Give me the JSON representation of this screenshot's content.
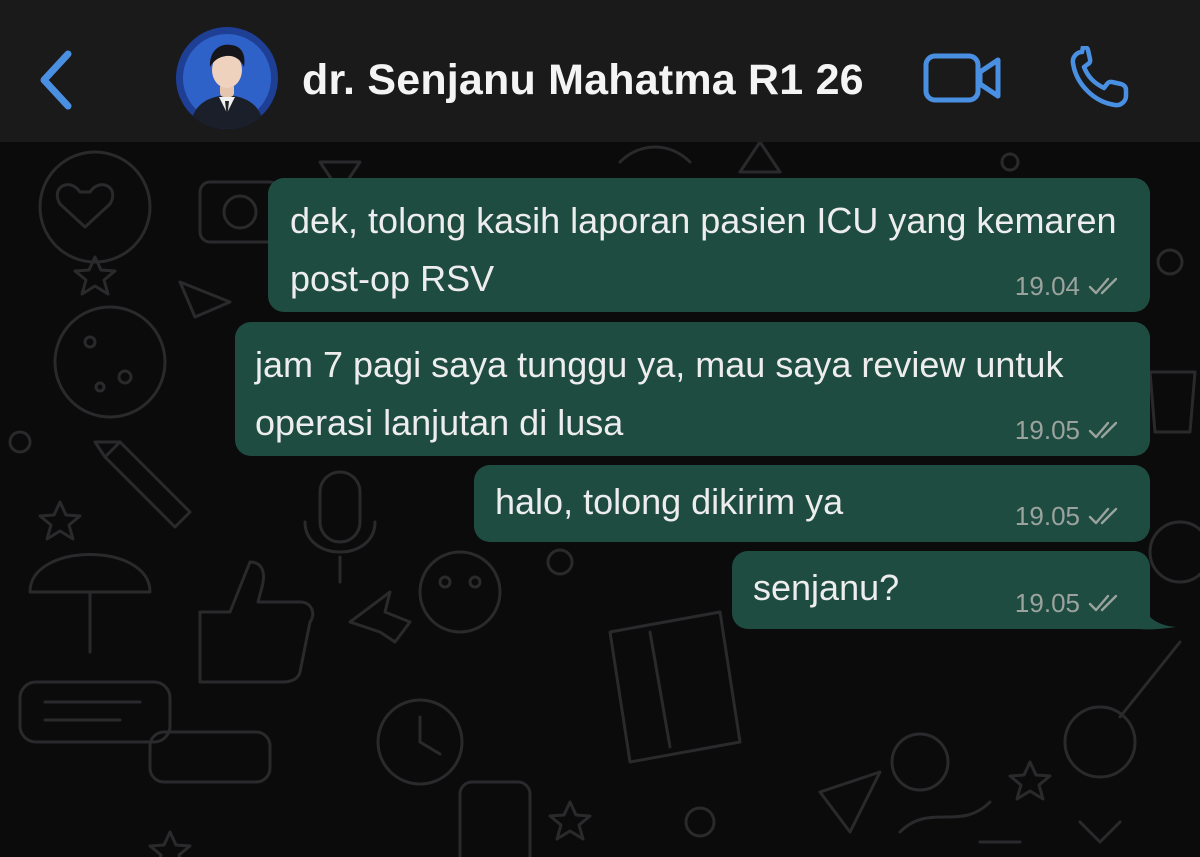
{
  "header": {
    "back_icon": "chevron-left-icon",
    "contact_name": "dr. Senjanu Mahatma R1 26",
    "video_icon": "video-camera-icon",
    "call_icon": "phone-icon",
    "accent_color": "#4a90e2"
  },
  "messages": [
    {
      "text": "dek, tolong kasih laporan pasien ICU yang kemaren post-op RSV",
      "time": "19.04",
      "status": "double-check-icon"
    },
    {
      "text": "jam 7 pagi saya tunggu ya, mau saya review untuk operasi lanjutan di lusa",
      "time": "19.05",
      "status": "double-check-icon"
    },
    {
      "text": "halo, tolong dikirim ya",
      "time": "19.05",
      "status": "double-check-icon"
    },
    {
      "text": "senjanu?",
      "time": "19.05",
      "status": "double-check-icon"
    }
  ],
  "colors": {
    "outgoing_bubble": "#1f4c40",
    "header_bg": "#1a1a1b",
    "chat_bg": "#0b0b0c"
  }
}
